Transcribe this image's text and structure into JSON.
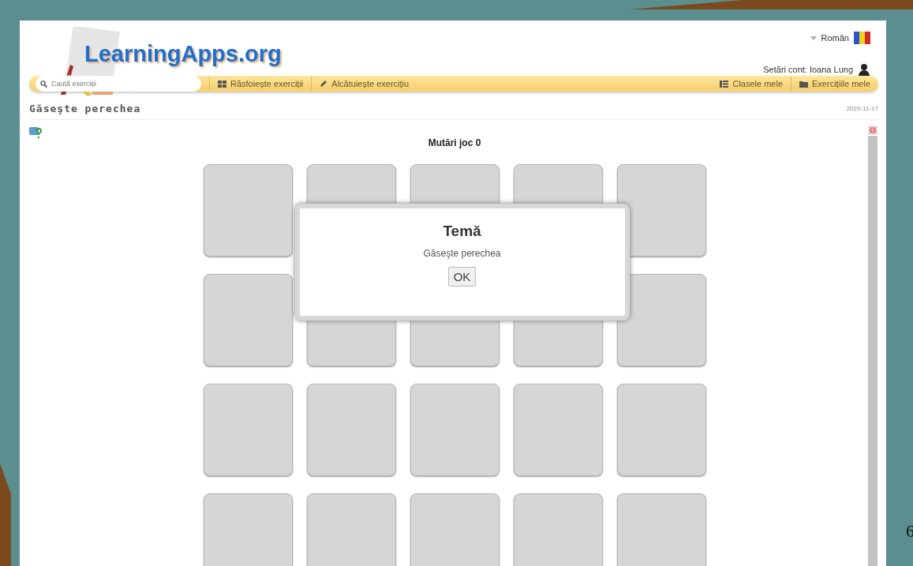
{
  "language": {
    "label": "Român"
  },
  "site": {
    "logo": "LearningApps.org"
  },
  "account": {
    "label": "Setări cont: Ioana Lung"
  },
  "search": {
    "placeholder": "Caută exerciții"
  },
  "nav": [
    {
      "kind": "grid",
      "label": "Răsfoiește exerciții"
    },
    {
      "kind": "pencil",
      "label": "Alcătuiește exercițiu"
    },
    {
      "kind": "columns",
      "label": "Clasele mele"
    },
    {
      "kind": "folder",
      "label": "Exercițiile mele"
    }
  ],
  "page": {
    "title": "Găseşte perechea",
    "date": "2020-11-17"
  },
  "game": {
    "moves": "Mutări joc 0"
  },
  "cards": [
    {
      "revealed": false
    },
    {
      "revealed": false
    },
    {
      "revealed": false
    },
    {
      "revealed": false
    },
    {
      "revealed": false
    },
    {
      "revealed": false
    },
    {
      "revealed": false
    },
    {
      "revealed": false
    },
    {
      "revealed": false
    },
    {
      "revealed": false
    },
    {
      "revealed": false
    },
    {
      "revealed": false
    },
    {
      "revealed": false
    },
    {
      "revealed": false
    },
    {
      "revealed": false
    },
    {
      "revealed": false
    },
    {
      "revealed": false
    },
    {
      "revealed": false
    },
    {
      "revealed": false
    },
    {
      "revealed": false
    }
  ],
  "dialog": {
    "title": "Temă",
    "message": "Găseşte perechea",
    "button": "OK"
  },
  "slide_number": "6"
}
